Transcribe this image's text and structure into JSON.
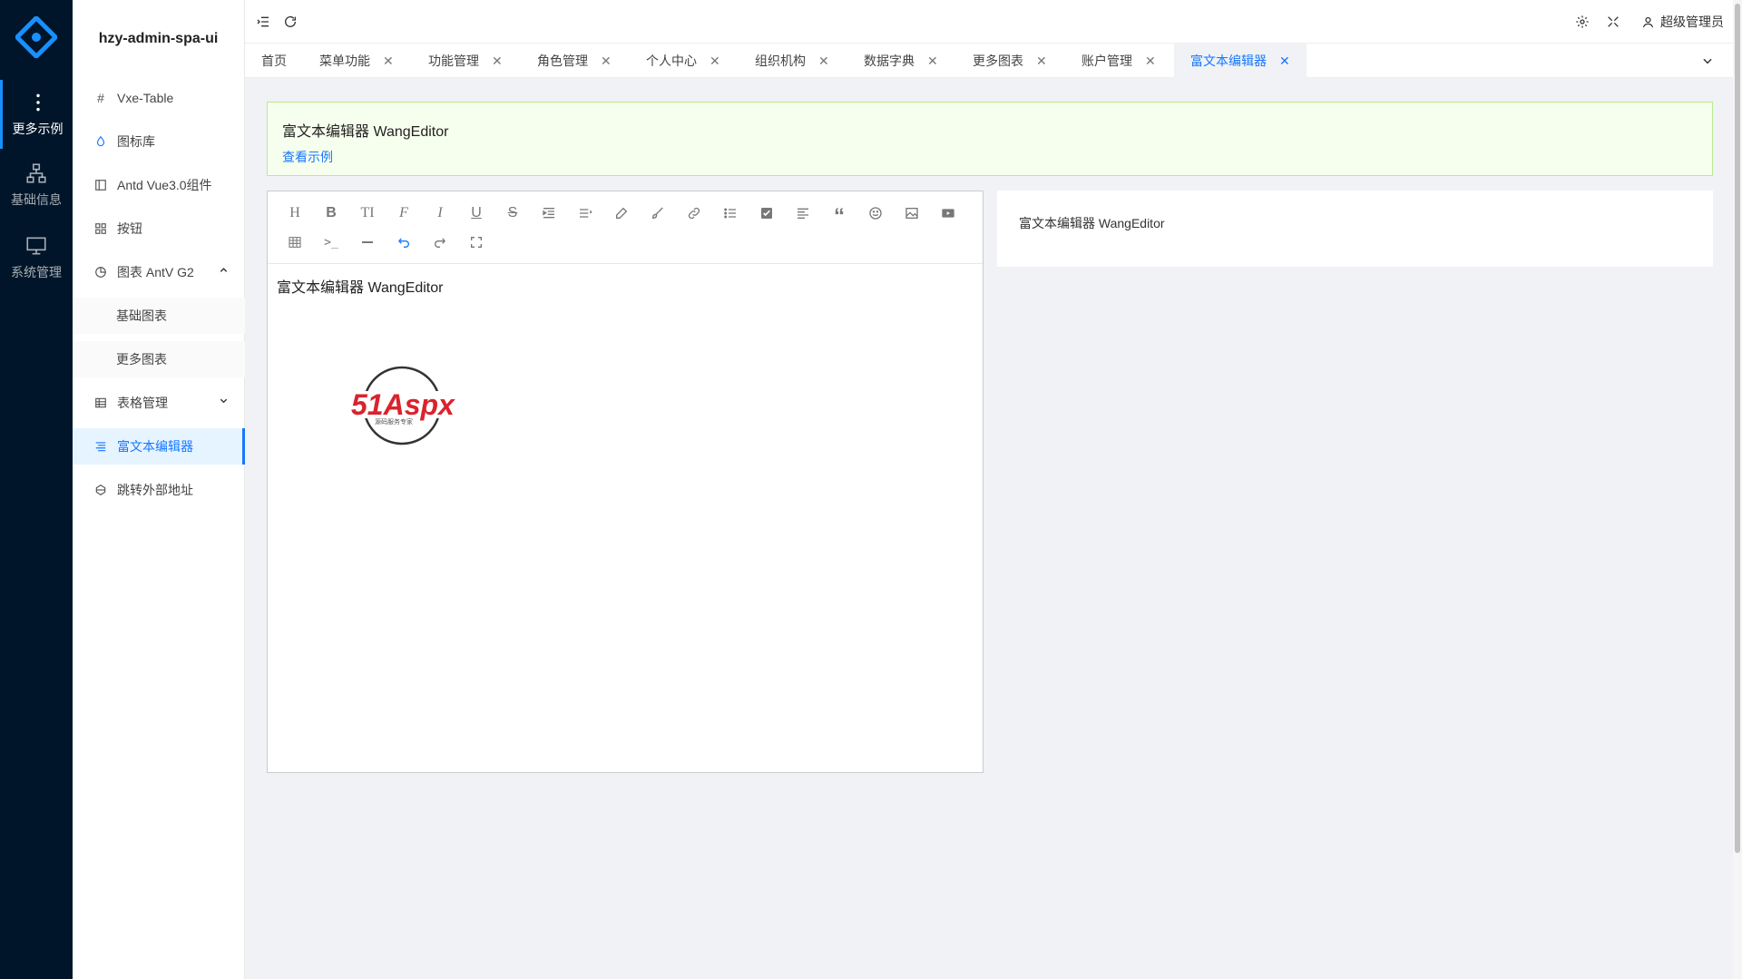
{
  "rail": {
    "items": [
      {
        "label": "更多示例",
        "icon": "more-vertical-icon"
      },
      {
        "label": "基础信息",
        "icon": "sitemap-icon"
      },
      {
        "label": "系统管理",
        "icon": "monitor-icon"
      }
    ]
  },
  "sidebar": {
    "title": "hzy-admin-spa-ui",
    "items": [
      {
        "label": "Vxe-Table",
        "icon": "hash-icon"
      },
      {
        "label": "图标库",
        "icon": "droplet-icon"
      },
      {
        "label": "Antd Vue3.0组件",
        "icon": "layout-icon"
      },
      {
        "label": "按钮",
        "icon": "grid-icon"
      },
      {
        "label": "图表 AntV G2",
        "icon": "pie-chart-icon"
      },
      {
        "label": "基础图表"
      },
      {
        "label": "更多图表"
      },
      {
        "label": "表格管理",
        "icon": "table-icon"
      },
      {
        "label": "富文本编辑器",
        "icon": "align-icon"
      },
      {
        "label": "跳转外部地址",
        "icon": "hive-icon"
      }
    ]
  },
  "header": {
    "user": "超级管理员"
  },
  "tabs": [
    {
      "label": "首页"
    },
    {
      "label": "菜单功能"
    },
    {
      "label": "功能管理"
    },
    {
      "label": "角色管理"
    },
    {
      "label": "个人中心"
    },
    {
      "label": "组织机构"
    },
    {
      "label": "数据字典"
    },
    {
      "label": "更多图表"
    },
    {
      "label": "账户管理"
    },
    {
      "label": "富文本编辑器"
    }
  ],
  "alert": {
    "title": "富文本编辑器 WangEditor",
    "link": "查看示例"
  },
  "editor": {
    "content": "富文本编辑器 WangEditor",
    "image_text": "51Aspx",
    "image_subtext": "源码服务专家"
  },
  "preview": {
    "content": "富文本编辑器 WangEditor"
  },
  "colors": {
    "rail_bg": "#001529",
    "accent": "#1677ff",
    "alert_bg": "#f6ffed",
    "alert_border": "#b7eb8f"
  }
}
